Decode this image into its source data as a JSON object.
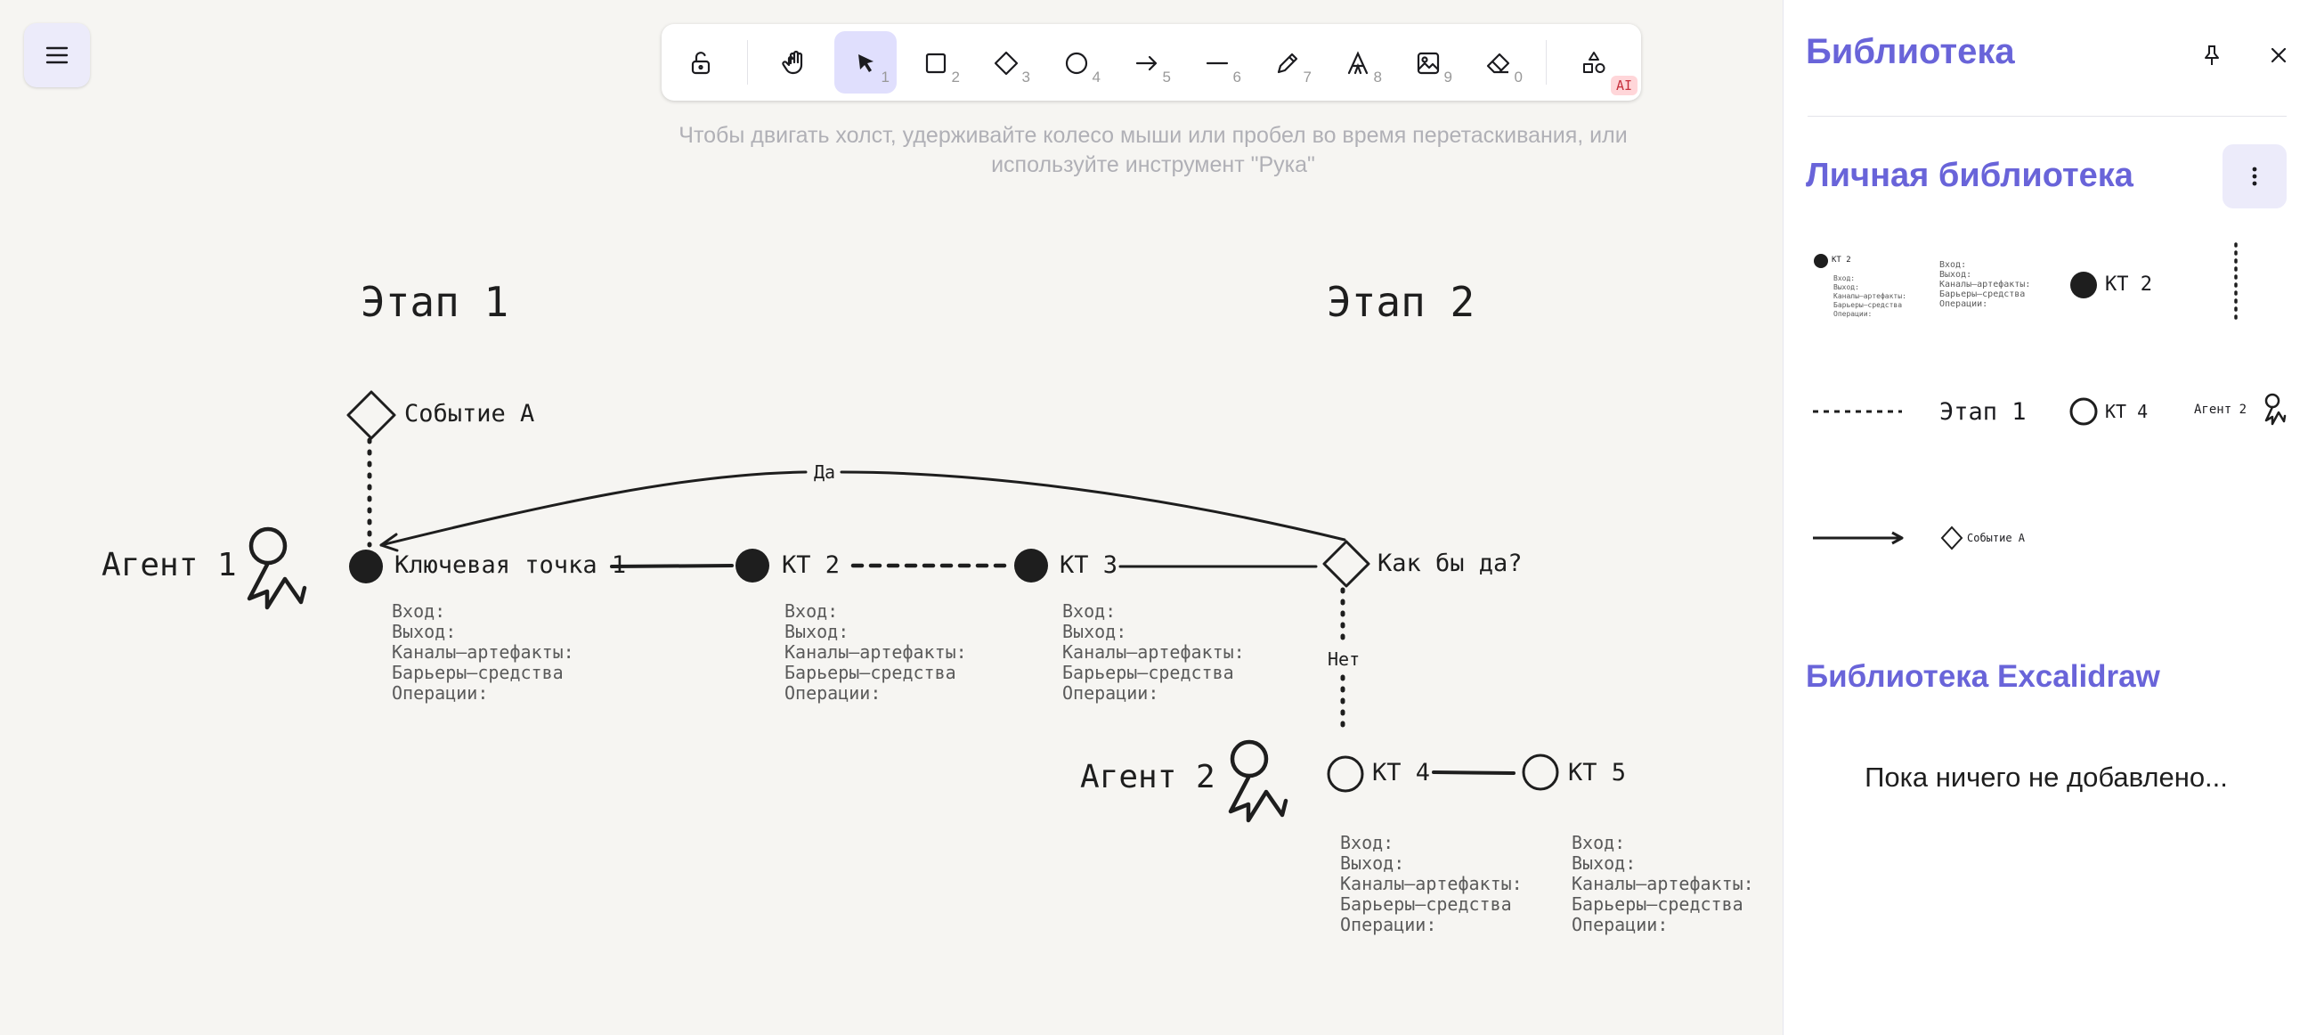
{
  "toolbar": {
    "tools": [
      {
        "name": "lock",
        "num": ""
      },
      {
        "name": "hand",
        "num": ""
      },
      {
        "name": "selection",
        "num": "1",
        "active": true
      },
      {
        "name": "rectangle",
        "num": "2"
      },
      {
        "name": "diamond",
        "num": "3"
      },
      {
        "name": "ellipse",
        "num": "4"
      },
      {
        "name": "arrow",
        "num": "5"
      },
      {
        "name": "line",
        "num": "6"
      },
      {
        "name": "draw",
        "num": "7"
      },
      {
        "name": "text",
        "num": "8"
      },
      {
        "name": "image",
        "num": "9"
      },
      {
        "name": "eraser",
        "num": "0"
      },
      {
        "name": "more-shapes",
        "num": ""
      }
    ],
    "ai_badge": "AI"
  },
  "hint": "Чтобы двигать холст, удерживайте колесо мыши или пробел во время перетаскивания, или используйте инструмент \"Рука\"",
  "canvas": {
    "stage1": "Этап 1",
    "stage2": "Этап 2",
    "agent1": "Агент 1",
    "agent2": "Агент 2",
    "event_a": "Событие А",
    "yes": "Да",
    "no": "Нет",
    "decision": "Как бы да?",
    "kt1": "Ключевая точка 1",
    "kt2": "КТ 2",
    "kt3": "КТ 3",
    "kt4": "КТ 4",
    "kt5": "КТ 5",
    "props": "Вход:\nВыход:\nКаналы—артефакты:\nБарьеры—средства\nОперации:"
  },
  "sidebar": {
    "title": "Библиотека",
    "personal_title": "Личная библиотека",
    "excalidraw_title": "Библиотека Excalidraw",
    "empty": "Пока ничего не добавлено...",
    "items": {
      "kt2": "КТ 2",
      "stage1": "Этап 1",
      "kt4": "КТ 4",
      "agent2": "Агент 2",
      "event_a": "Событие А",
      "mini_kt2": "КТ 2",
      "mini_props": "Вход:\nВыход:\nКаналы—артефакты:\nБарьеры—средства\nОперации:"
    }
  }
}
